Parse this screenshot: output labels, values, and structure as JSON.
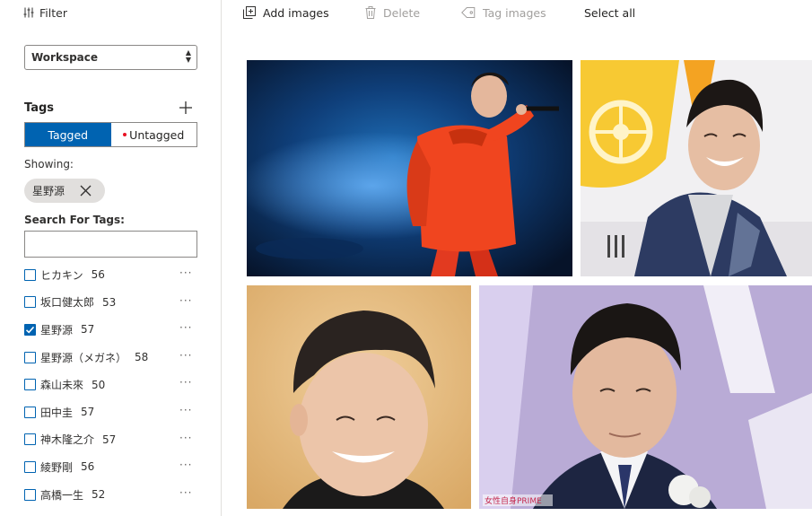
{
  "filter": {
    "label": "Filter"
  },
  "workspace": {
    "selected": "Workspace"
  },
  "tags": {
    "title": "Tags",
    "toggle": {
      "tagged": "Tagged",
      "untagged": "Untagged",
      "active": "tagged"
    },
    "showing_label": "Showing:",
    "active_filter_chip": "星野源",
    "search_label": "Search For Tags:",
    "search_value": "",
    "search_placeholder": "",
    "list": [
      {
        "name": "ヒカキン",
        "count": "56",
        "checked": false
      },
      {
        "name": "坂口健太郎",
        "count": "53",
        "checked": false
      },
      {
        "name": "星野源",
        "count": "57",
        "checked": true
      },
      {
        "name": "星野源（メガネ）",
        "count": "58",
        "checked": false
      },
      {
        "name": "森山未來",
        "count": "50",
        "checked": false
      },
      {
        "name": "田中圭",
        "count": "57",
        "checked": false
      },
      {
        "name": "神木隆之介",
        "count": "57",
        "checked": false
      },
      {
        "name": "綾野剛",
        "count": "56",
        "checked": false
      },
      {
        "name": "高橋一生",
        "count": "52",
        "checked": false
      }
    ],
    "more_glyph": "···"
  },
  "toolbar": {
    "add_images": "Add images",
    "delete": "Delete",
    "tag_images": "Tag images",
    "select_all": "Select all"
  },
  "gallery": {
    "images": [
      {
        "watermark": ""
      },
      {
        "watermark": ""
      },
      {
        "watermark": ""
      },
      {
        "watermark": "女性自身PRIME"
      }
    ]
  },
  "colors": {
    "accent": "#0063b1",
    "untagged_dot": "#e81123",
    "chip_bg": "#e1dfdd",
    "disabled_text": "#a19f9d"
  },
  "icons": [
    "filter-icon",
    "add-icon",
    "close-icon",
    "add-images-icon",
    "delete-icon",
    "tag-icon",
    "checkmark-icon",
    "more-icon"
  ]
}
